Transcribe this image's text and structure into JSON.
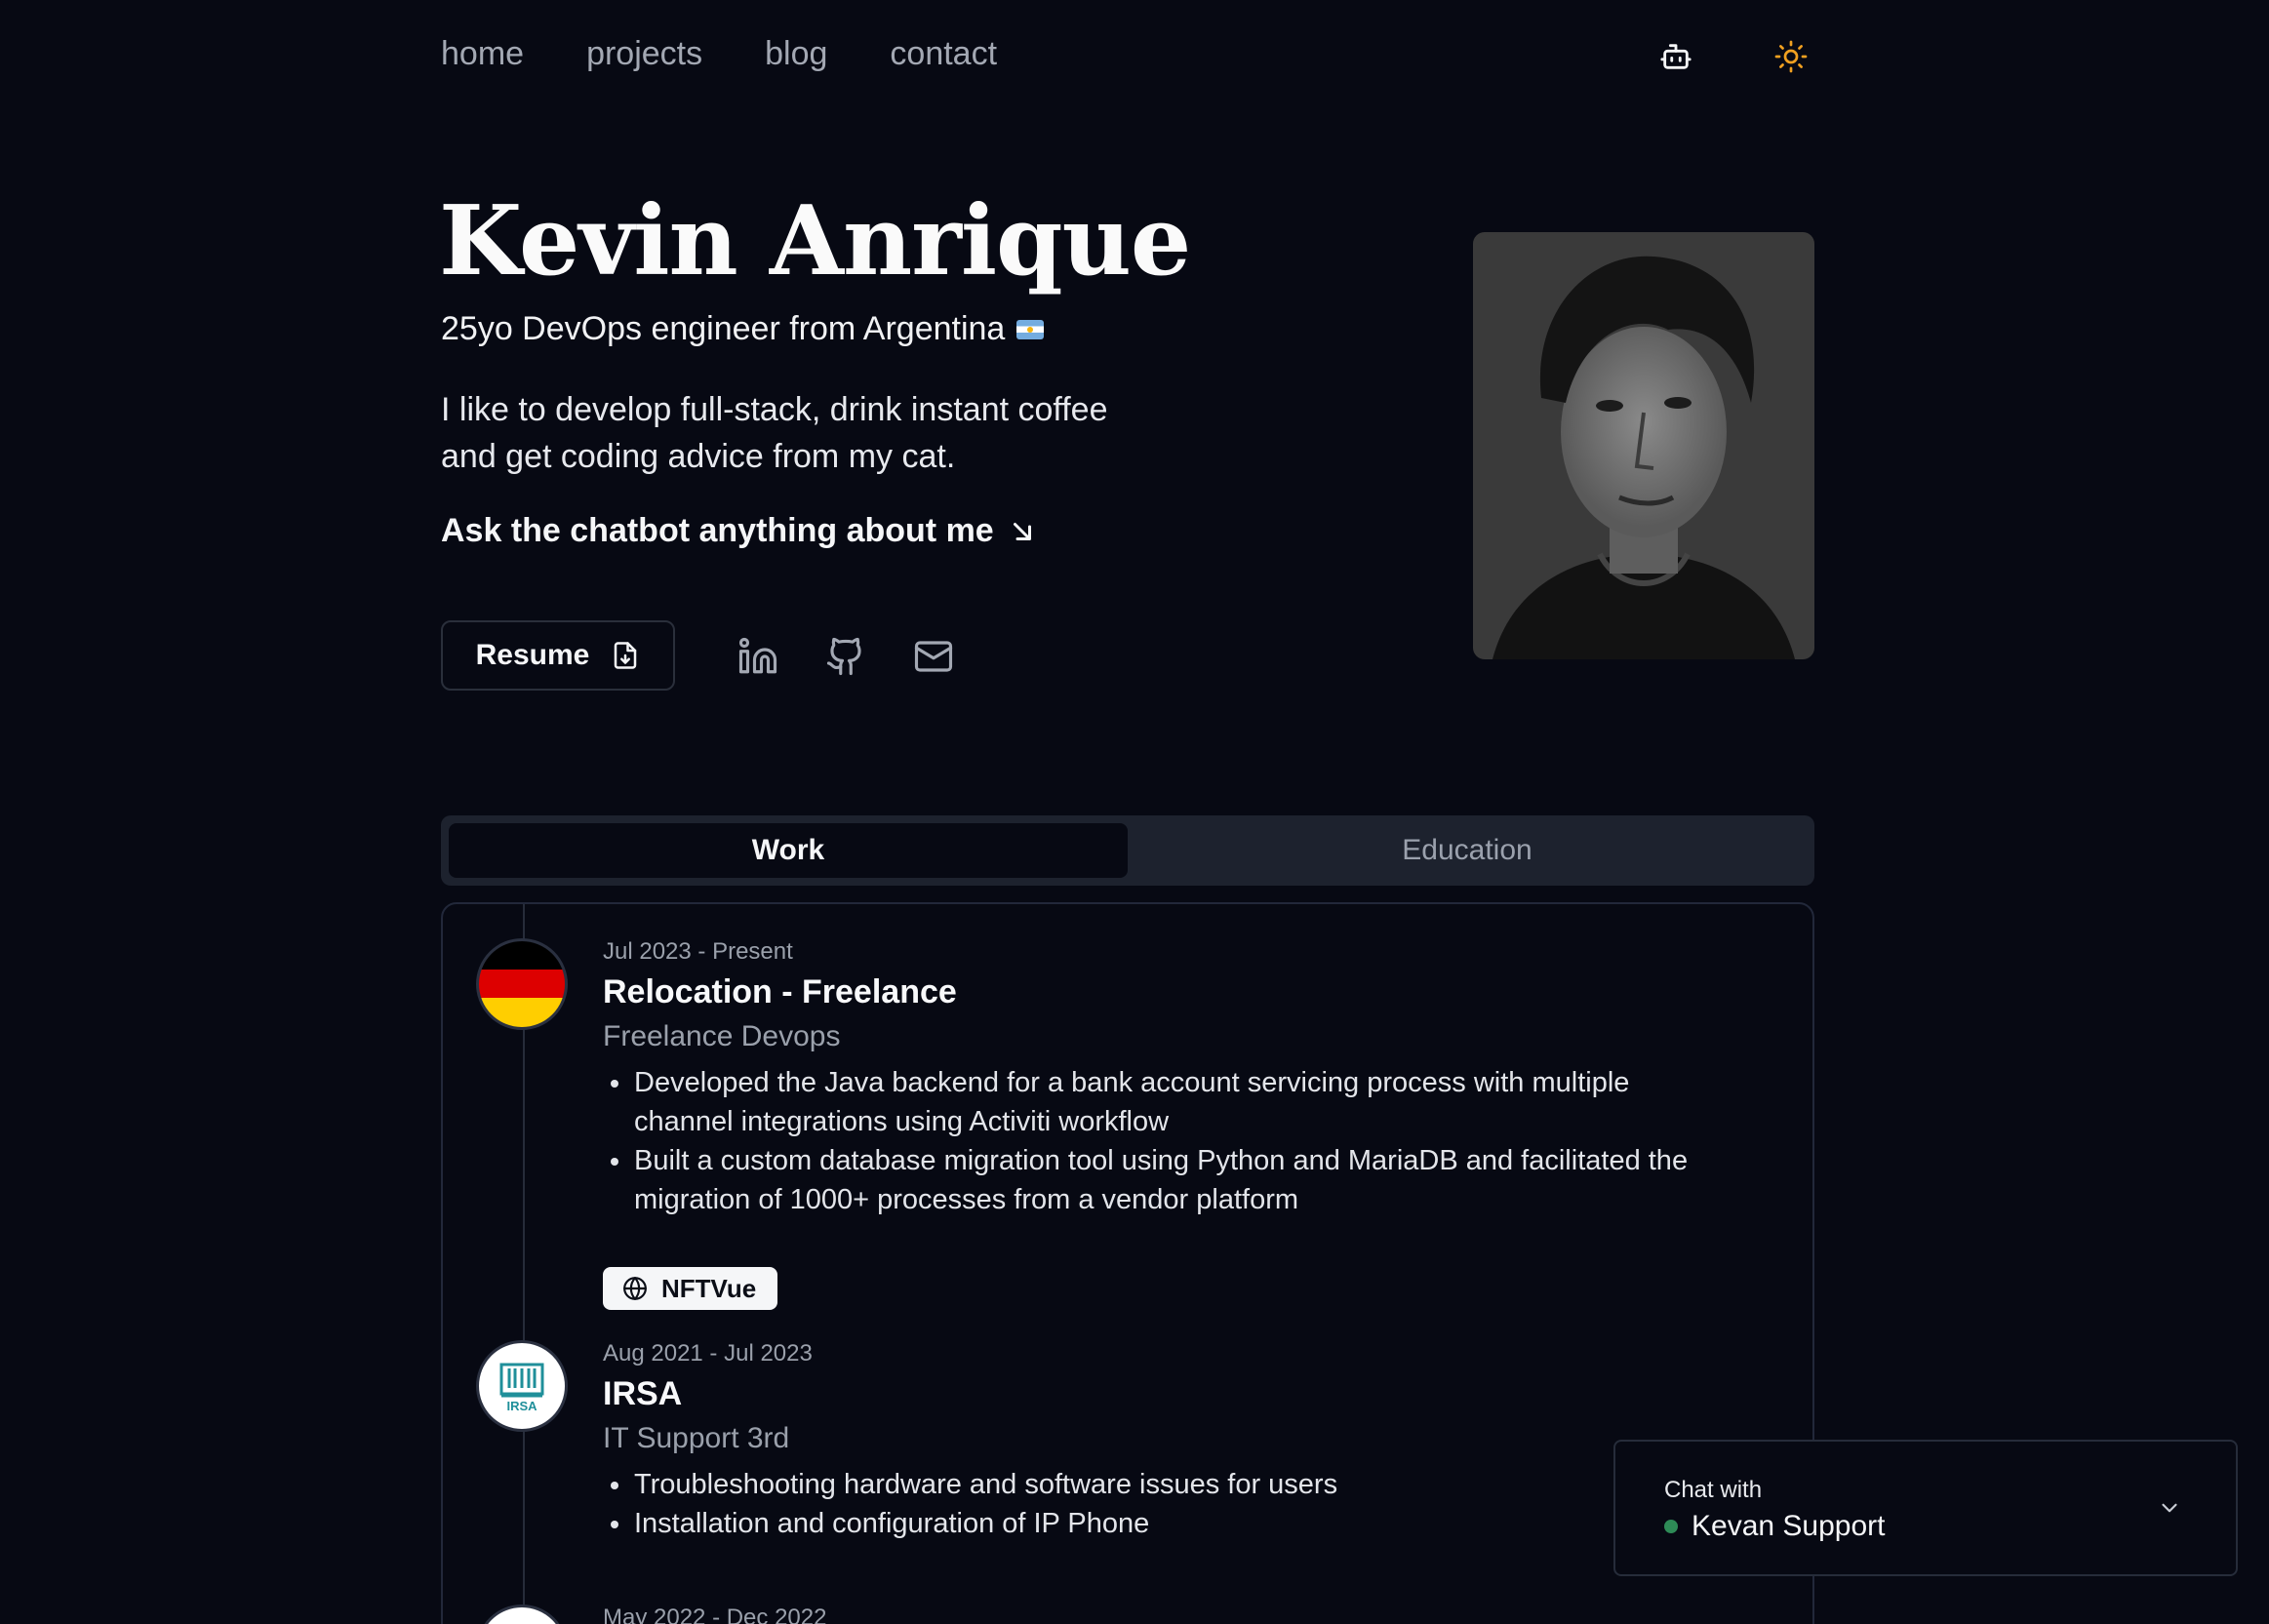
{
  "nav": {
    "links": [
      "home",
      "projects",
      "blog",
      "contact"
    ],
    "icons": [
      "robot-icon",
      "sun-icon"
    ]
  },
  "hero": {
    "name": "Kevin Anrique",
    "subtitle": "25yo DevOps engineer from Argentina",
    "bio": "I like to develop full-stack, drink instant coffee and get coding advice from my cat.",
    "cta": "Ask the chatbot anything about me",
    "resume_label": "Resume",
    "social_icons": [
      "linkedin-icon",
      "github-icon",
      "mail-icon"
    ]
  },
  "tabs": {
    "work": "Work",
    "education": "Education",
    "active": "work"
  },
  "experience": [
    {
      "date": "Jul 2023 - Present",
      "title": "Relocation - Freelance",
      "role": "Freelance Devops",
      "bullets": [
        "Developed the Java backend for a bank account servicing process with multiple channel integrations using Activiti workflow",
        "Built a custom database migration tool using Python and MariaDB and facilitated the migration of 1000+ processes from a vendor platform"
      ],
      "link_label": "NFTVue",
      "logo": "germany-flag"
    },
    {
      "date": "Aug 2021 - Jul 2023",
      "title": "IRSA",
      "role": "IT Support 3rd",
      "bullets": [
        "Troubleshooting hardware and software issues for users",
        "Installation and configuration of IP Phone"
      ],
      "logo": "irsa-logo"
    },
    {
      "date": "May 2022 - Dec 2022",
      "logo": "blank-logo"
    }
  ],
  "chat": {
    "label": "Chat with",
    "name": "Kevan Support",
    "status_color": "#2e8b57"
  },
  "colors": {
    "background": "#070913",
    "tab_bar": "#1d222e",
    "muted_text": "#9aa0ab",
    "sun_accent": "#f0a020"
  }
}
